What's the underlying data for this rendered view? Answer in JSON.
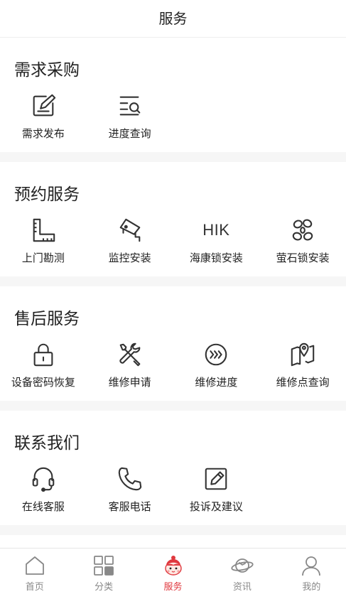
{
  "header": {
    "title": "服务"
  },
  "sections": [
    {
      "title": "需求采购",
      "items": [
        {
          "label": "需求发布",
          "icon": "edit-square-icon"
        },
        {
          "label": "进度查询",
          "icon": "list-search-icon"
        }
      ]
    },
    {
      "title": "预约服务",
      "items": [
        {
          "label": "上门勘测",
          "icon": "ruler-icon"
        },
        {
          "label": "监控安装",
          "icon": "camera-icon"
        },
        {
          "label": "海康锁安装",
          "icon": "hik-logo-icon",
          "icon_text": "HIK"
        },
        {
          "label": "萤石锁安装",
          "icon": "ezviz-logo-icon"
        }
      ]
    },
    {
      "title": "售后服务",
      "items": [
        {
          "label": "设备密码恢复",
          "icon": "lock-icon"
        },
        {
          "label": "维修申请",
          "icon": "tools-icon"
        },
        {
          "label": "维修进度",
          "icon": "progress-arrows-icon"
        },
        {
          "label": "维修点查询",
          "icon": "map-pin-icon"
        }
      ]
    },
    {
      "title": "联系我们",
      "items": [
        {
          "label": "在线客服",
          "icon": "headset-icon"
        },
        {
          "label": "客服电话",
          "icon": "phone-icon"
        },
        {
          "label": "投诉及建议",
          "icon": "feedback-edit-icon"
        }
      ]
    }
  ],
  "tabbar": {
    "active_color": "#e0383e",
    "items": [
      {
        "label": "首页",
        "icon": "home-icon"
      },
      {
        "label": "分类",
        "icon": "grid-icon"
      },
      {
        "label": "服务",
        "icon": "mascot-icon",
        "active": true
      },
      {
        "label": "资讯",
        "icon": "planet-icon"
      },
      {
        "label": "我的",
        "icon": "user-icon"
      }
    ]
  }
}
